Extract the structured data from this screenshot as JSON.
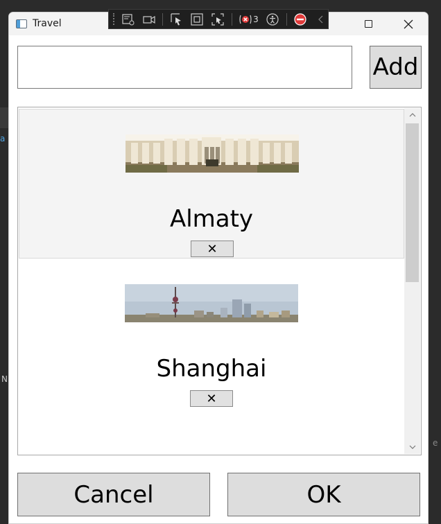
{
  "window": {
    "title": "Travel"
  },
  "debug_toolbar": {
    "icons": [
      "live-visual-tree-icon",
      "record-icon",
      "select-element-icon",
      "display-layout-adorners-icon",
      "track-focus-icon",
      "binding-failures-icon",
      "accessibility-checker-icon",
      "hot-reload-icon",
      "collapse-icon"
    ],
    "binding_failures_count": "3"
  },
  "input": {
    "value": "",
    "placeholder": ""
  },
  "add_label": "Add",
  "items": [
    {
      "name": "Almaty",
      "remove_label": "✕",
      "selected": true
    },
    {
      "name": "Shanghai",
      "remove_label": "✕",
      "selected": false
    }
  ],
  "cancel_label": "Cancel",
  "ok_label": "OK",
  "background": {
    "left_text_1": "a",
    "left_text_2": "N",
    "right_text": "e"
  }
}
